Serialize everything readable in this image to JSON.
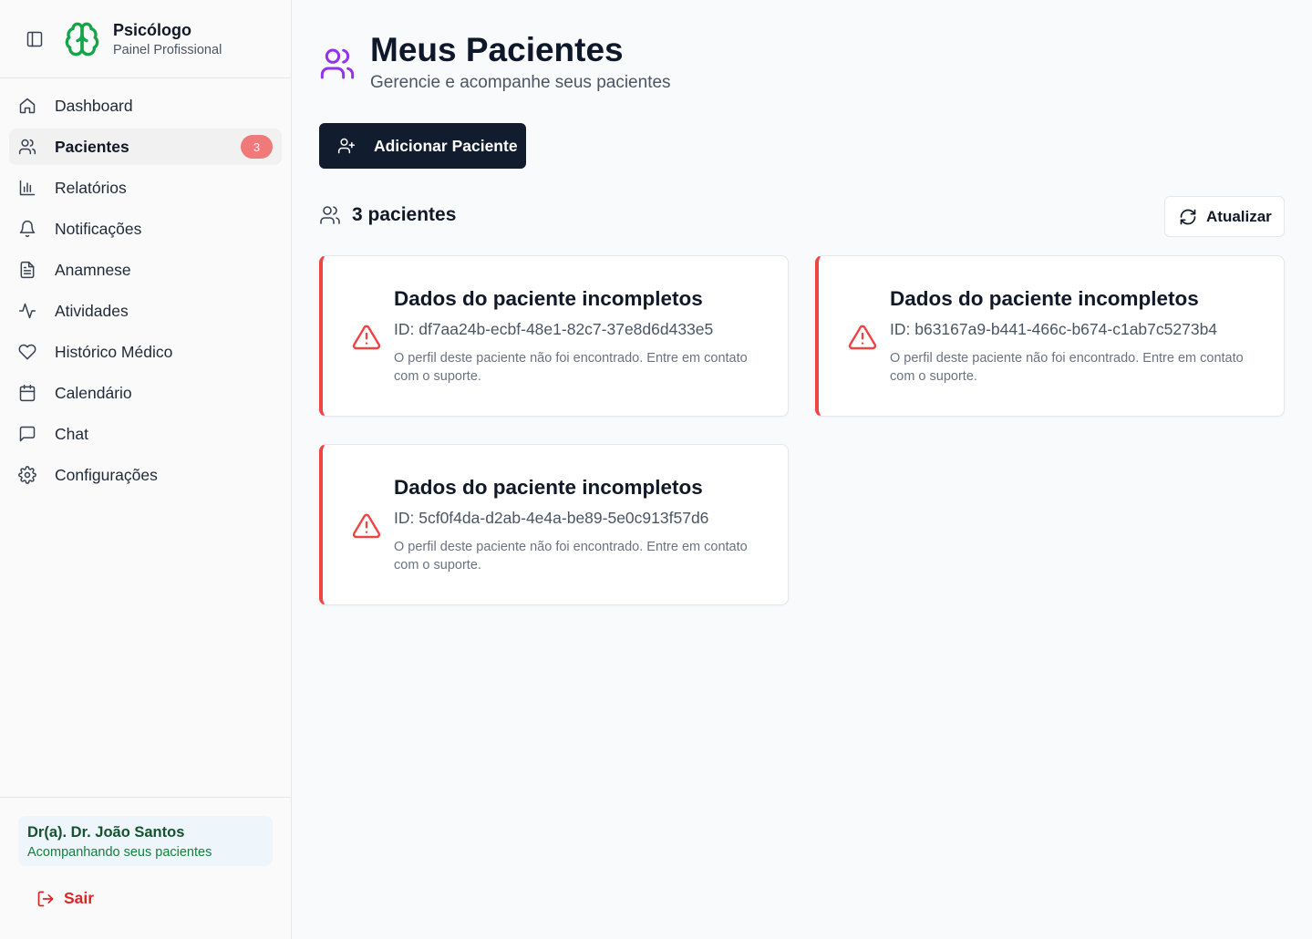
{
  "app": {
    "title": "Psicólogo",
    "subtitle": "Painel Profissional"
  },
  "sidebar": {
    "items": [
      {
        "label": "Dashboard",
        "icon": "home-icon"
      },
      {
        "label": "Pacientes",
        "icon": "users-icon",
        "badge": "3",
        "active": true
      },
      {
        "label": "Relatórios",
        "icon": "bar-chart-icon"
      },
      {
        "label": "Notificações",
        "icon": "bell-icon"
      },
      {
        "label": "Anamnese",
        "icon": "file-text-icon"
      },
      {
        "label": "Atividades",
        "icon": "activity-icon"
      },
      {
        "label": "Histórico Médico",
        "icon": "heart-icon"
      },
      {
        "label": "Calendário",
        "icon": "calendar-icon"
      },
      {
        "label": "Chat",
        "icon": "message-square-icon"
      },
      {
        "label": "Configurações",
        "icon": "settings-icon"
      }
    ]
  },
  "user": {
    "name": "Dr(a). Dr. João Santos",
    "subtitle": "Acompanhando seus pacientes",
    "logout_label": "Sair"
  },
  "main": {
    "title": "Meus Pacientes",
    "subtitle": "Gerencie e acompanhe seus pacientes",
    "add_button_label": "Adicionar Paciente",
    "count_label": "3 pacientes",
    "refresh_label": "Atualizar"
  },
  "patients": [
    {
      "title": "Dados do paciente incompletos",
      "id": "ID: df7aa24b-ecbf-48e1-82c7-37e8d6d433e5",
      "message": "O perfil deste paciente não foi encontrado. Entre em contato com o suporte."
    },
    {
      "title": "Dados do paciente incompletos",
      "id": "ID: b63167a9-b441-466c-b674-c1ab7c5273b4",
      "message": "O perfil deste paciente não foi encontrado. Entre em contato com o suporte."
    },
    {
      "title": "Dados do paciente incompletos",
      "id": "ID: 5cf0f4da-d2ab-4e4a-be89-5e0c913f57d6",
      "message": "O perfil deste paciente não foi encontrado. Entre em contato com o suporte."
    }
  ],
  "colors": {
    "brand": "#16a34a",
    "accent_purple": "#9333ea",
    "primary_button": "#111c2e",
    "danger": "#ef4444",
    "badge": "#f07a7a"
  }
}
